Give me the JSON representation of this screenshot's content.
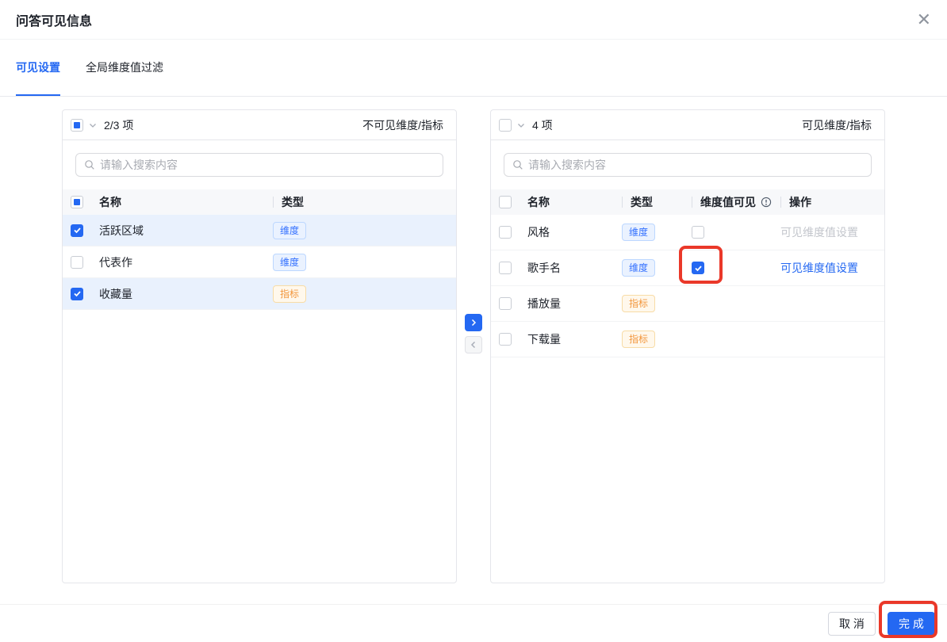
{
  "dialog": {
    "title": "问答可见信息"
  },
  "tabs": {
    "visible_settings": "可见设置",
    "global_dimension_filter": "全局维度值过滤"
  },
  "left_panel": {
    "count": "2/3 项",
    "label": "不可见维度/指标",
    "search_placeholder": "请输入搜索内容",
    "columns": {
      "name": "名称",
      "type": "类型"
    },
    "rows": [
      {
        "name": "活跃区域",
        "type": "维度",
        "checked": true
      },
      {
        "name": "代表作",
        "type": "维度",
        "checked": false
      },
      {
        "name": "收藏量",
        "type": "指标",
        "checked": true
      }
    ]
  },
  "right_panel": {
    "count": "4 项",
    "label": "可见维度/指标",
    "search_placeholder": "请输入搜索内容",
    "columns": {
      "name": "名称",
      "type": "类型",
      "dim_visible": "维度值可见",
      "action": "操作"
    },
    "rows": [
      {
        "name": "风格",
        "type": "维度",
        "dim_visible_checked": false,
        "action": "可见维度值设置",
        "action_enabled": false
      },
      {
        "name": "歌手名",
        "type": "维度",
        "dim_visible_checked": true,
        "action": "可见维度值设置",
        "action_enabled": true,
        "highlighted": true
      },
      {
        "name": "播放量",
        "type": "指标"
      },
      {
        "name": "下载量",
        "type": "指标"
      }
    ]
  },
  "footer": {
    "cancel": "取 消",
    "done": "完 成"
  },
  "colors": {
    "accent": "#2468f2",
    "annotation_red": "#ea3829",
    "tag_dimension_text": "#3370ff",
    "tag_metric_text": "#f2963c",
    "selected_row_bg": "#e9f1fd"
  }
}
